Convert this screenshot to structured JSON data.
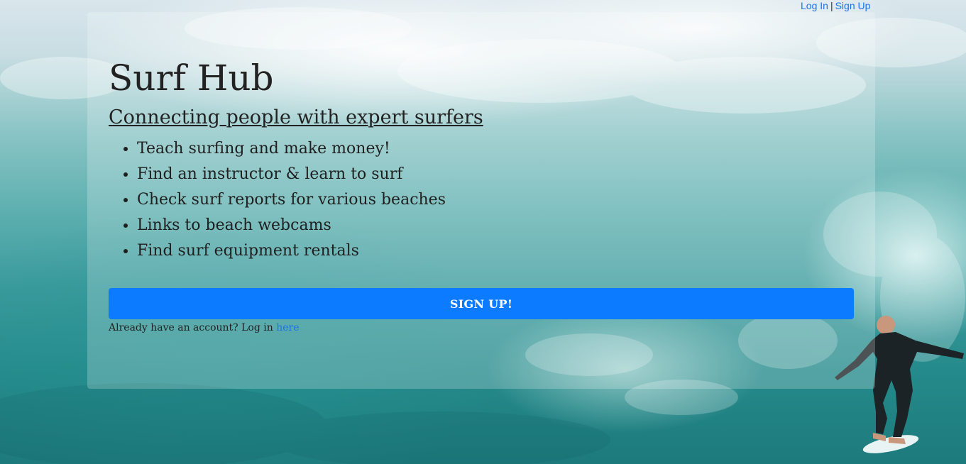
{
  "header": {
    "login_link": "Log In",
    "separator": "|",
    "signup_link": "Sign Up"
  },
  "hero": {
    "title": "Surf Hub",
    "subtitle": "Connecting people with expert surfers",
    "features": [
      "Teach surfing and make money!",
      "Find an instructor & learn to surf",
      "Check surf reports for various beaches",
      "Links to beach webcams",
      "Find surf equipment rentals"
    ],
    "signup_button": "SIGN UP!",
    "login_prompt": "Already have an account? Log in",
    "login_here_link": "here"
  },
  "colors": {
    "accent": "#0d7bff",
    "link": "#1a73e8",
    "text": "#222222"
  },
  "background": {
    "image_icon": "ocean-wave-surfer"
  }
}
